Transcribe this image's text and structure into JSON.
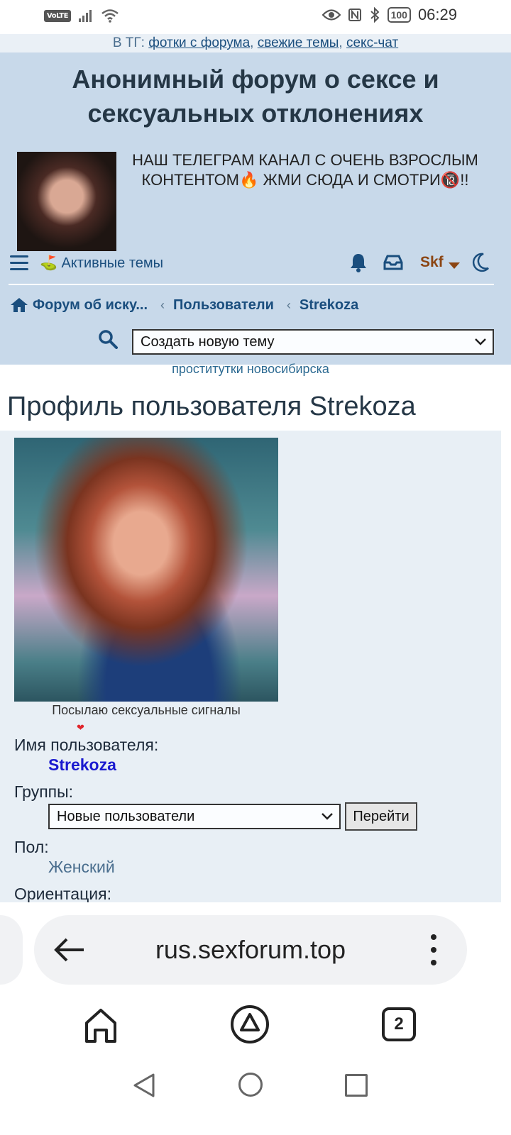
{
  "status_bar": {
    "volte": "VoLTE",
    "battery": "100",
    "time": "06:29",
    "icons": [
      "signal-icon",
      "wifi-icon",
      "eye-icon",
      "nfc-icon",
      "bluetooth-icon"
    ]
  },
  "telegram_line": {
    "prefix": "В ТГ: ",
    "links": [
      "фотки с форума",
      "свежие темы",
      "секс-чат"
    ],
    "separator": ", "
  },
  "header": {
    "site_title": "Анонимный форум о сексе и сексуальных отклонениях",
    "promo_text": "НАШ ТЕЛЕГРАМ КАНАЛ С ОЧЕНЬ ВЗРОСЛЫМ КОНТЕНТОМ🔥 ЖМИ СЮДА И СМОТРИ🔞!!"
  },
  "navbar": {
    "active_topics_icon": "⛳",
    "active_topics": "Активные темы",
    "username": "Skf"
  },
  "breadcrumbs": {
    "items": [
      "Форум об иску...",
      "Пользователи",
      "Strekoza"
    ],
    "separator": "‹"
  },
  "new_topic": {
    "selected": "Создать новую тему"
  },
  "ad_link": "проститутки новосибирска",
  "page_title": "Профиль пользователя Strekoza",
  "profile": {
    "status_message": "Посылаю сексуальные сигналы",
    "heart": "❤",
    "username_label": "Имя пользователя:",
    "username": "Strekoza",
    "groups_label": "Группы:",
    "groups_selected": "Новые пользователи",
    "go_button": "Перейти",
    "gender_label": "Пол:",
    "gender": "Женский",
    "orientation_label": "Ориентация:"
  },
  "browser": {
    "url": "rus.sexforum.top",
    "tab_count": "2"
  },
  "colors": {
    "header_bg": "#c8d9ea",
    "link": "#1a4e7e",
    "username_link": "#1a1acf",
    "user_menu": "#8b4513",
    "panel_bg": "#e8eff5"
  }
}
